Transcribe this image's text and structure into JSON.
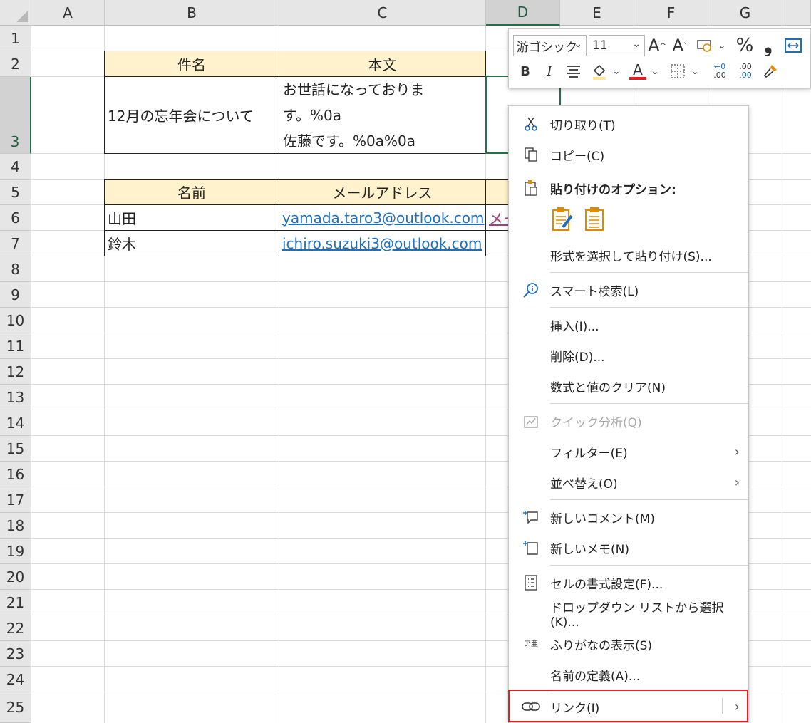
{
  "columns": [
    "A",
    "B",
    "C",
    "D",
    "E",
    "F",
    "G"
  ],
  "rows": [
    "1",
    "2",
    "3",
    "4",
    "5",
    "6",
    "7",
    "8",
    "9",
    "10",
    "11",
    "12",
    "13",
    "14",
    "15",
    "16",
    "17",
    "18",
    "19",
    "20",
    "21",
    "22",
    "23",
    "24",
    "25"
  ],
  "table1": {
    "headers": [
      "件名",
      "本文"
    ],
    "subject": "12月の忘年会について",
    "body_lines": [
      "お世話になっておりま",
      "す。%0a",
      "佐藤です。%0a%0a"
    ]
  },
  "table2": {
    "headers": [
      "名前",
      "メールアドレス"
    ],
    "rows": [
      {
        "name": "山田",
        "email": "yamada.taro3@outlook.com"
      },
      {
        "name": "鈴木",
        "email": "ichiro.suzuki3@outlook.com"
      }
    ],
    "d6_partial": "メー"
  },
  "toolbar": {
    "font_name": "游ゴシック",
    "font_size": "11",
    "bold": "B",
    "italic": "I",
    "percent": "%",
    "comma": "❟",
    "font_color_letter": "A",
    "grow_font": "A",
    "shrink_font": "A",
    "dec_inc": ".00",
    "dec_dec": ".00",
    "dec_inc_top": "←0",
    "dec_dec_top": ".00",
    "accent": "#e02020"
  },
  "menu": {
    "cut": "切り取り(T)",
    "copy": "コピー(C)",
    "paste_options": "貼り付けのオプション:",
    "paste_special": "形式を選択して貼り付け(S)...",
    "smart_lookup": "スマート検索(L)",
    "insert": "挿入(I)...",
    "delete": "削除(D)...",
    "clear": "数式と値のクリア(N)",
    "quick_analysis": "クイック分析(Q)",
    "filter": "フィルター(E)",
    "sort": "並べ替え(O)",
    "new_comment": "新しいコメント(M)",
    "new_note": "新しいメモ(N)",
    "format_cells": "セルの書式設定(F)...",
    "dropdown": "ドロップダウン リストから選択(K)...",
    "furigana": "ふりがなの表示(S)",
    "define_name": "名前の定義(A)...",
    "link": "リンク(I)",
    "furigana_icon": "ア亜"
  },
  "colors": {
    "selection_green": "#217346",
    "header_fill": "#fff2cc",
    "link_blue": "#1f6fbf",
    "highlight_red": "#e02020"
  }
}
